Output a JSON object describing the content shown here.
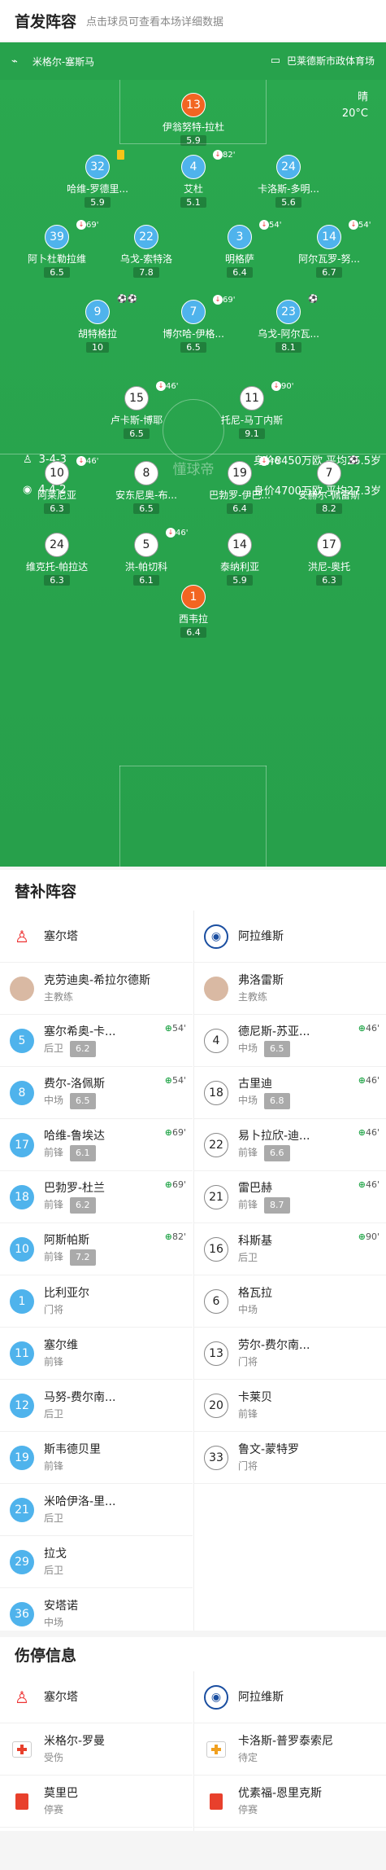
{
  "lineup": {
    "title": "首发阵容",
    "subtitle": "点击球员可查看本场详细数据",
    "home_team": "米格尔-塞斯马",
    "away_team": "巴莱德斯市政体育场",
    "weather": "晴",
    "temperature": "20°C",
    "watermark": "懂球帝"
  },
  "home_form": {
    "formation": "3-4-3",
    "stats": "身价8450万欧 平均25.5岁"
  },
  "away_form": {
    "formation": "4-4-2",
    "stats": "身价4700万欧 平均27.3岁"
  },
  "home_players": [
    {
      "num": "13",
      "name": "伊翁努特-拉杜",
      "rating": "5.9",
      "gk": true,
      "evt": ""
    },
    {
      "num": "32",
      "name": "哈维-罗德里...",
      "rating": "5.9",
      "evt": "yc"
    },
    {
      "num": "4",
      "name": "艾杜",
      "rating": "5.1",
      "evt": "82'"
    },
    {
      "num": "24",
      "name": "卡洛斯-多明...",
      "rating": "5.6",
      "evt": ""
    },
    {
      "num": "39",
      "name": "阿卜杜勒拉维",
      "rating": "6.5",
      "evt": "69'"
    },
    {
      "num": "22",
      "name": "乌戈-索特洛",
      "rating": "7.8",
      "evt": ""
    },
    {
      "num": "3",
      "name": "明格萨",
      "rating": "6.4",
      "evt": "54'"
    },
    {
      "num": "14",
      "name": "阿尔瓦罗-努...",
      "rating": "6.7",
      "evt": "54'"
    },
    {
      "num": "9",
      "name": "胡特格拉",
      "rating": "10",
      "evt": "⚽⚽"
    },
    {
      "num": "7",
      "name": "博尔哈-伊格...",
      "rating": "6.5",
      "evt": "69'"
    },
    {
      "num": "23",
      "name": "乌戈-阿尔瓦...",
      "rating": "8.1",
      "evt": "⚽"
    }
  ],
  "away_players": [
    {
      "num": "15",
      "name": "卢卡斯-博耶",
      "rating": "6.5",
      "evt": "46'"
    },
    {
      "num": "11",
      "name": "托尼-马丁内斯",
      "rating": "9.1",
      "evt": "90'"
    },
    {
      "num": "10",
      "name": "阿莱尼亚",
      "rating": "6.3",
      "evt": "46'"
    },
    {
      "num": "8",
      "name": "安东尼奥-布...",
      "rating": "6.5",
      "evt": ""
    },
    {
      "num": "19",
      "name": "巴勃罗-伊巴...",
      "rating": "6.4",
      "evt": "46'"
    },
    {
      "num": "7",
      "name": "安赫尔-佩雷斯",
      "rating": "8.2",
      "evt": "⚽"
    },
    {
      "num": "24",
      "name": "维克托-帕拉达",
      "rating": "6.3",
      "evt": ""
    },
    {
      "num": "5",
      "name": "洪-帕切科",
      "rating": "6.1",
      "evt": "46'"
    },
    {
      "num": "14",
      "name": "泰纳利亚",
      "rating": "5.9",
      "evt": ""
    },
    {
      "num": "17",
      "name": "洪尼-奥托",
      "rating": "6.3",
      "evt": ""
    },
    {
      "num": "1",
      "name": "西韦拉",
      "rating": "6.4",
      "gk": true,
      "evt": ""
    }
  ],
  "subs": {
    "title": "替补阵容",
    "home_team": "塞尔塔",
    "away_team": "阿拉维斯",
    "home_coach": {
      "name": "克劳迪奥-希拉尔德斯",
      "role": "主教练"
    },
    "away_coach": {
      "name": "弗洛雷斯",
      "role": "主教练"
    },
    "home": [
      {
        "num": "5",
        "name": "塞尔希奥-卡...",
        "pos": "后卫",
        "rating": "6.2",
        "ev": "54'"
      },
      {
        "num": "8",
        "name": "费尔-洛佩斯",
        "pos": "中场",
        "rating": "6.5",
        "ev": "54'"
      },
      {
        "num": "17",
        "name": "哈维-鲁埃达",
        "pos": "前锋",
        "rating": "6.1",
        "ev": "69'"
      },
      {
        "num": "18",
        "name": "巴勃罗-杜兰",
        "pos": "前锋",
        "rating": "6.2",
        "ev": "69'"
      },
      {
        "num": "10",
        "name": "阿斯帕斯",
        "pos": "前锋",
        "rating": "7.2",
        "ev": "82'"
      },
      {
        "num": "1",
        "name": "比利亚尔",
        "pos": "门将",
        "rating": "",
        "ev": ""
      },
      {
        "num": "11",
        "name": "塞尔维",
        "pos": "前锋",
        "rating": "",
        "ev": ""
      },
      {
        "num": "12",
        "name": "马努-费尔南...",
        "pos": "后卫",
        "rating": "",
        "ev": ""
      },
      {
        "num": "19",
        "name": "斯韦德贝里",
        "pos": "前锋",
        "rating": "",
        "ev": ""
      },
      {
        "num": "21",
        "name": "米哈伊洛-里...",
        "pos": "后卫",
        "rating": "",
        "ev": ""
      },
      {
        "num": "29",
        "name": "拉戈",
        "pos": "后卫",
        "rating": "",
        "ev": ""
      },
      {
        "num": "36",
        "name": "安塔诺",
        "pos": "中场",
        "rating": "",
        "ev": ""
      }
    ],
    "away": [
      {
        "num": "4",
        "name": "德尼斯-苏亚...",
        "pos": "中场",
        "rating": "6.5",
        "ev": "46'"
      },
      {
        "num": "18",
        "name": "古里迪",
        "pos": "中场",
        "rating": "6.8",
        "ev": "46'"
      },
      {
        "num": "22",
        "name": "易卜拉欣-迪...",
        "pos": "前锋",
        "rating": "6.6",
        "ev": "46'"
      },
      {
        "num": "21",
        "name": "雷巴赫",
        "pos": "前锋",
        "rating": "8.7",
        "ev": "46'"
      },
      {
        "num": "16",
        "name": "科斯基",
        "pos": "后卫",
        "rating": "",
        "ev": "90'"
      },
      {
        "num": "6",
        "name": "格瓦拉",
        "pos": "中场",
        "rating": "",
        "ev": ""
      },
      {
        "num": "13",
        "name": "劳尔-费尔南...",
        "pos": "门将",
        "rating": "",
        "ev": ""
      },
      {
        "num": "20",
        "name": "卡莱贝",
        "pos": "前锋",
        "rating": "",
        "ev": ""
      },
      {
        "num": "33",
        "name": "鲁文-蒙特罗",
        "pos": "门将",
        "rating": "",
        "ev": ""
      }
    ]
  },
  "injuries": {
    "title": "伤停信息",
    "home_team": "塞尔塔",
    "away_team": "阿拉维斯",
    "home": [
      {
        "name": "米格尔-罗曼",
        "status": "受伤"
      },
      {
        "name": "莫里巴",
        "status": "停赛"
      }
    ],
    "away": [
      {
        "name": "卡洛斯-普罗泰索尼",
        "status": "待定"
      },
      {
        "name": "优素福-恩里克斯",
        "status": "停赛"
      }
    ]
  }
}
